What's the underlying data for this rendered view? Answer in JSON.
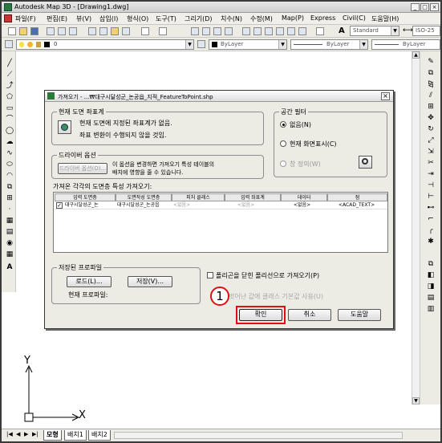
{
  "window": {
    "title": "Autodesk Map 3D - [Drawing1.dwg]"
  },
  "menu": [
    "파일(F)",
    "편집(E)",
    "뷰(V)",
    "삽입(I)",
    "형식(O)",
    "도구(T)",
    "그리기(D)",
    "치수(N)",
    "수정(M)",
    "Map(P)",
    "Express",
    "Civil(C)",
    "도움말(H)"
  ],
  "toolbar": {
    "textstyle": "Standard",
    "dimstyle": "ISO-25",
    "layer": "0",
    "color": "ByLayer",
    "linetype": "ByLayer",
    "lineweight": "ByLayer"
  },
  "dialog": {
    "title": "가져오기 - ...₩대구시달성군_논공읍_지적_FeatureToPoint.shp",
    "current_crs": {
      "label": "현재 도면 좌표계",
      "line1": "현재 도면에 지정된 좌표계가 없음.",
      "line2": "좌표 변환이 수행되지 않을 것임."
    },
    "spatial_filter": {
      "label": "공간 필터",
      "options": [
        "없음(N)",
        "현재 화면표시(C)",
        "창 정의(W)"
      ]
    },
    "driver_options": {
      "label": "드라이버 옵션",
      "button": "드라이버 옵션(O)...",
      "text1": "이 옵션을 변경하면 가져오기 특성 테이블의",
      "text2": "배치에 영향을 줄 수 있습니다."
    },
    "grid_caption": "가져온 각각의 도면층 특성 가져오기:",
    "columns": [
      "입력 도면층",
      "도면작성 도면층",
      "피처 클래스",
      "입력 좌표계",
      "데이터",
      "점"
    ],
    "row": [
      "대구시달성군_논",
      "대구시달성군_논공읍",
      "<없음>",
      "<없음>",
      "<없음>",
      "<ACAD_TEXT>"
    ],
    "saved_profile": {
      "label": "저장된 프로파일",
      "load": "로드(L)...",
      "save": "저장(V)...",
      "current": "현재 프로파일:"
    },
    "import_polygons": "폴리곤을 닫힌 폴리선으로 가져오기(P)",
    "faded_option": "벗어난 값에 클래스 기본값 사용(U)",
    "callout": "1",
    "ok": "확인",
    "cancel": "취소",
    "help": "도움말"
  },
  "ucs": {
    "y": "Y",
    "x": "X"
  },
  "tabs": [
    "모형",
    "배치1",
    "배치2"
  ]
}
